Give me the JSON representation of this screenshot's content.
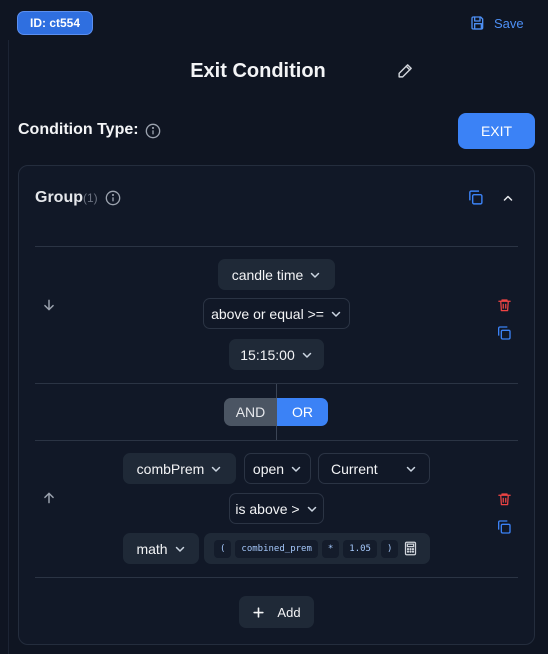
{
  "header": {
    "id_badge": "ID: ct554",
    "save_label": "Save",
    "title": "Exit Condition"
  },
  "condition": {
    "type_label": "Condition Type:",
    "type_value": "EXIT"
  },
  "group": {
    "label": "Group",
    "count": "(1)",
    "conditions": [
      {
        "lhs": "candle time",
        "operator": "above or equal >=",
        "rhs": "15:15:00"
      },
      {
        "lhs": "combPrem",
        "lhs_field": "open",
        "lhs_period": "Current",
        "operator": "is above >",
        "rhs_type": "math",
        "rhs_tokens": [
          "(",
          "combined_prem",
          "*",
          "1.05",
          ")"
        ]
      }
    ],
    "logic": {
      "and_label": "AND",
      "or_label": "OR",
      "selected": "OR"
    },
    "add_label": "Add"
  },
  "colors": {
    "accent": "#3b82f6",
    "danger": "#ef4444",
    "background": "#0f1522"
  }
}
